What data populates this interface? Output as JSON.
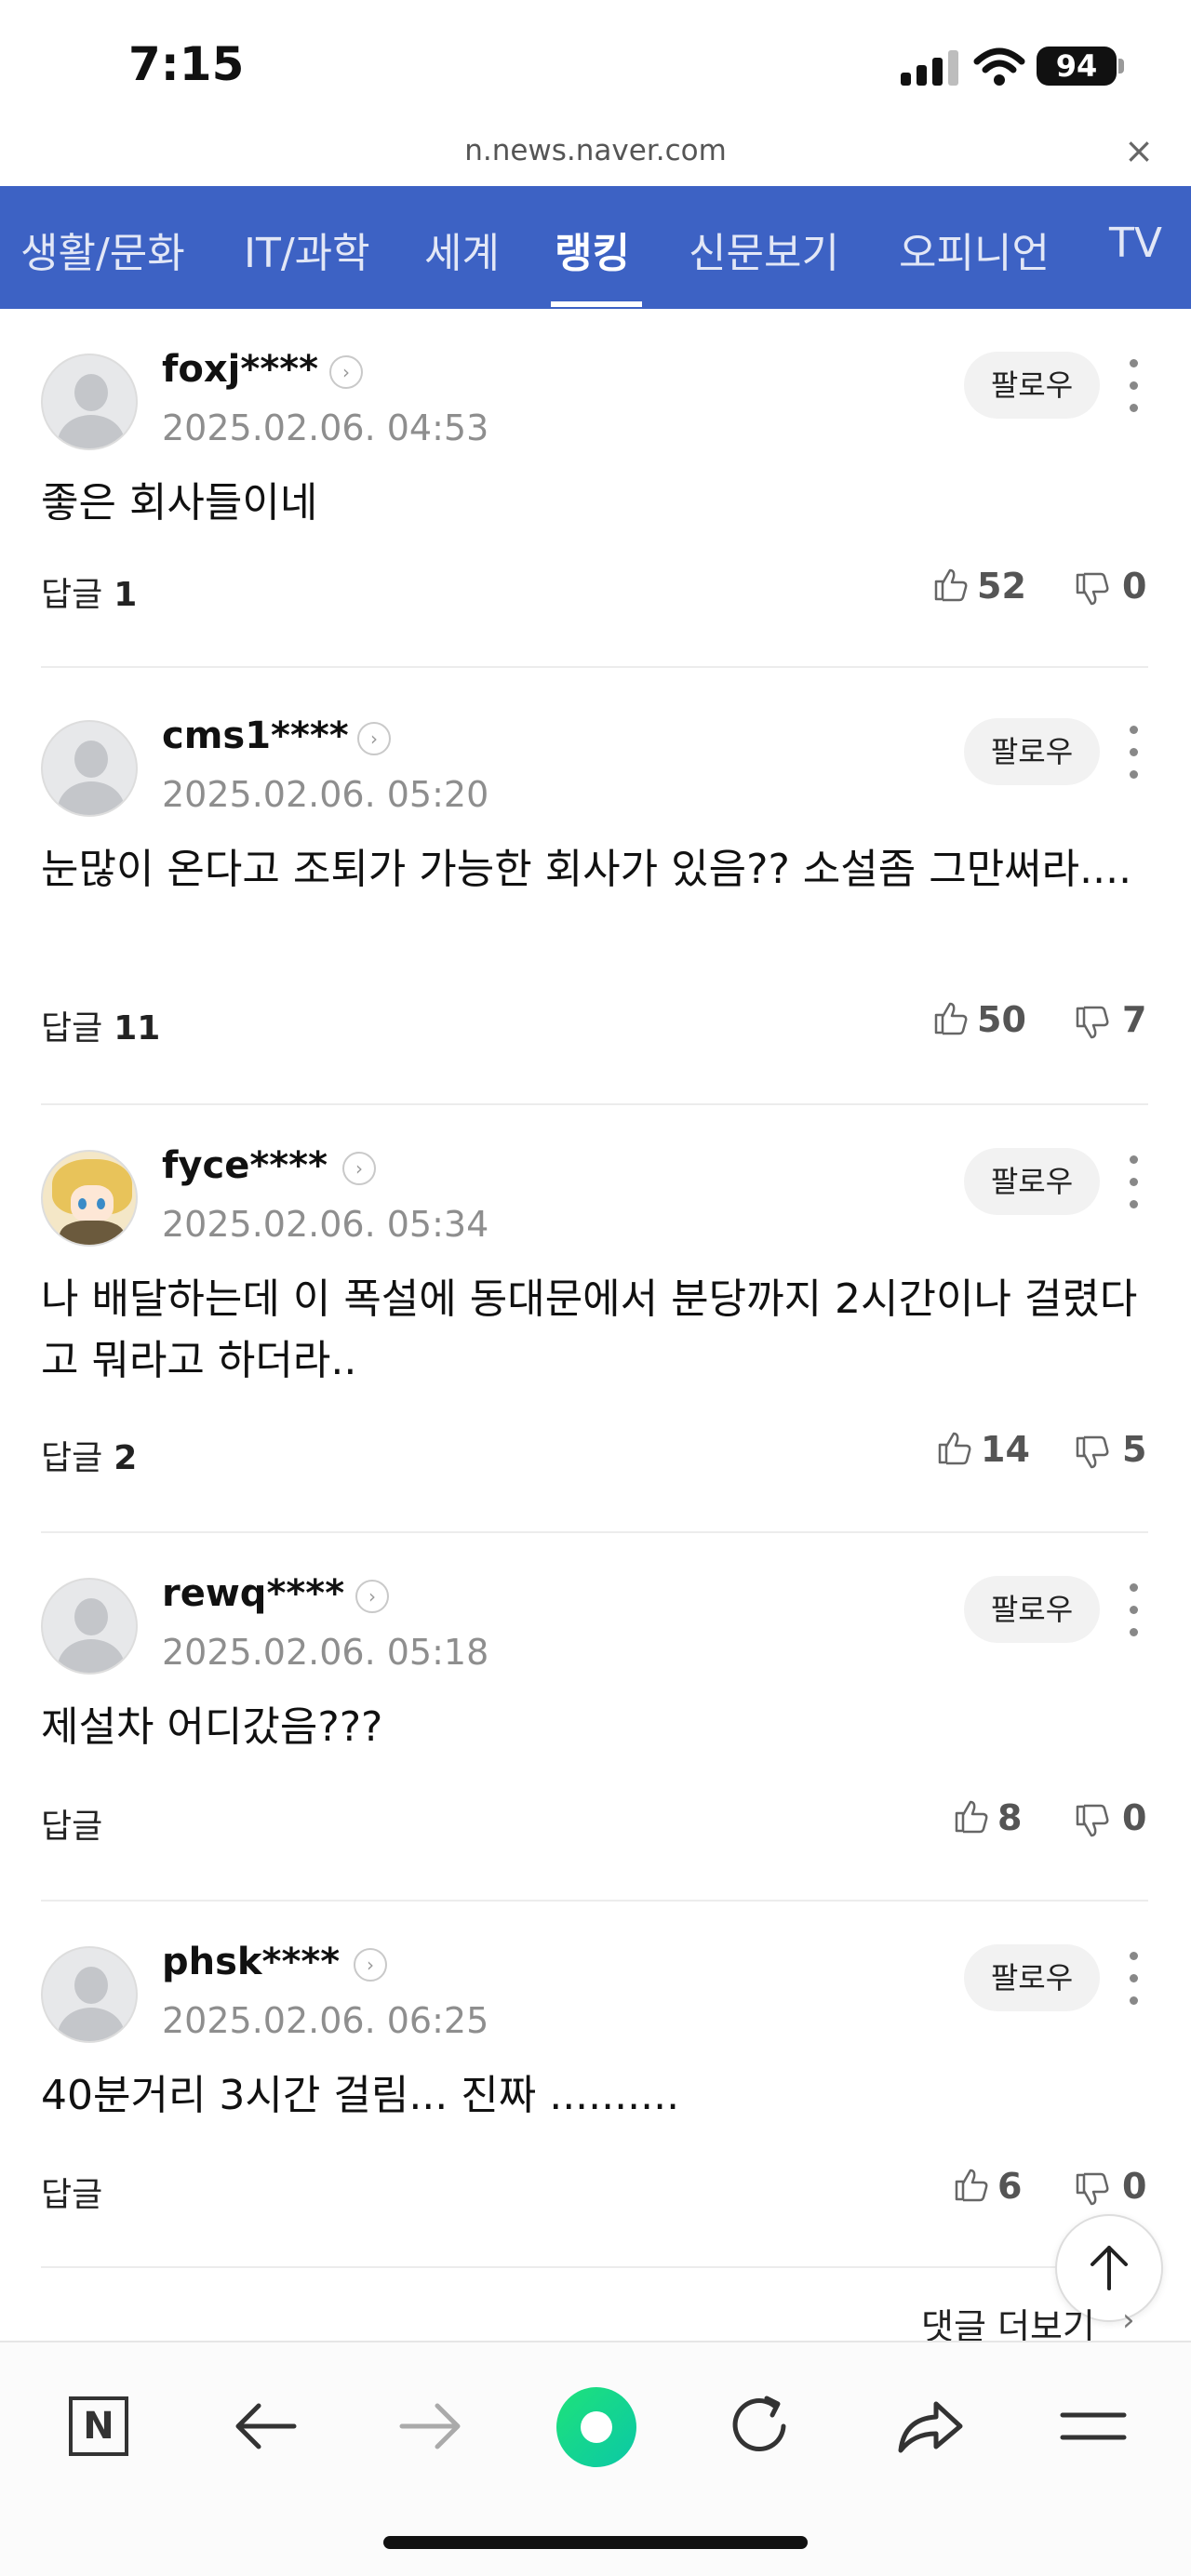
{
  "status_bar": {
    "time": "7:15",
    "battery": "94"
  },
  "url_bar": {
    "url": "n.news.naver.com",
    "close_icon": "×"
  },
  "categories": [
    {
      "label": "생활/문화",
      "active": false
    },
    {
      "label": "IT/과학",
      "active": false
    },
    {
      "label": "세계",
      "active": false
    },
    {
      "label": "랭킹",
      "active": true
    },
    {
      "label": "신문보기",
      "active": false
    },
    {
      "label": "오피니언",
      "active": false
    },
    {
      "label": "TV",
      "active": false
    }
  ],
  "follow_label": "팔로우",
  "reply_label": "답글",
  "comments": [
    {
      "username": "foxj****",
      "timestamp": "2025.02.06. 04:53",
      "text": "좋은 회사들이네",
      "replies": "1",
      "likes": "52",
      "dislikes": "0",
      "avatar": "default"
    },
    {
      "username": "cms1****",
      "timestamp": "2025.02.06. 05:20",
      "text": "눈많이 온다고 조퇴가 가능한 회사가 있음?? 소설좀 그만써라....",
      "replies": "11",
      "likes": "50",
      "dislikes": "7",
      "avatar": "default"
    },
    {
      "username": "fyce****",
      "timestamp": "2025.02.06. 05:34",
      "text": "나 배달하는데 이 폭설에 동대문에서 분당까지 2시간이나 걸렸다고 뭐라고 하더라..",
      "replies": "2",
      "likes": "14",
      "dislikes": "5",
      "avatar": "anime"
    },
    {
      "username": "rewq****",
      "timestamp": "2025.02.06. 05:18",
      "text": "제설차 어디갔음???",
      "replies": "",
      "likes": "8",
      "dislikes": "0",
      "avatar": "default"
    },
    {
      "username": "phsk****",
      "timestamp": "2025.02.06. 06:25",
      "text": "40분거리 3시간 걸림... 진짜 ..........",
      "replies": "",
      "likes": "6",
      "dislikes": "0",
      "avatar": "default"
    }
  ],
  "more_comments": {
    "label": "댓글 더보기",
    "arrow": "›"
  },
  "toolbar": {
    "naver_label": "N"
  },
  "colors": {
    "nav_bg": "#3d62c4",
    "green": "#12d48c"
  }
}
